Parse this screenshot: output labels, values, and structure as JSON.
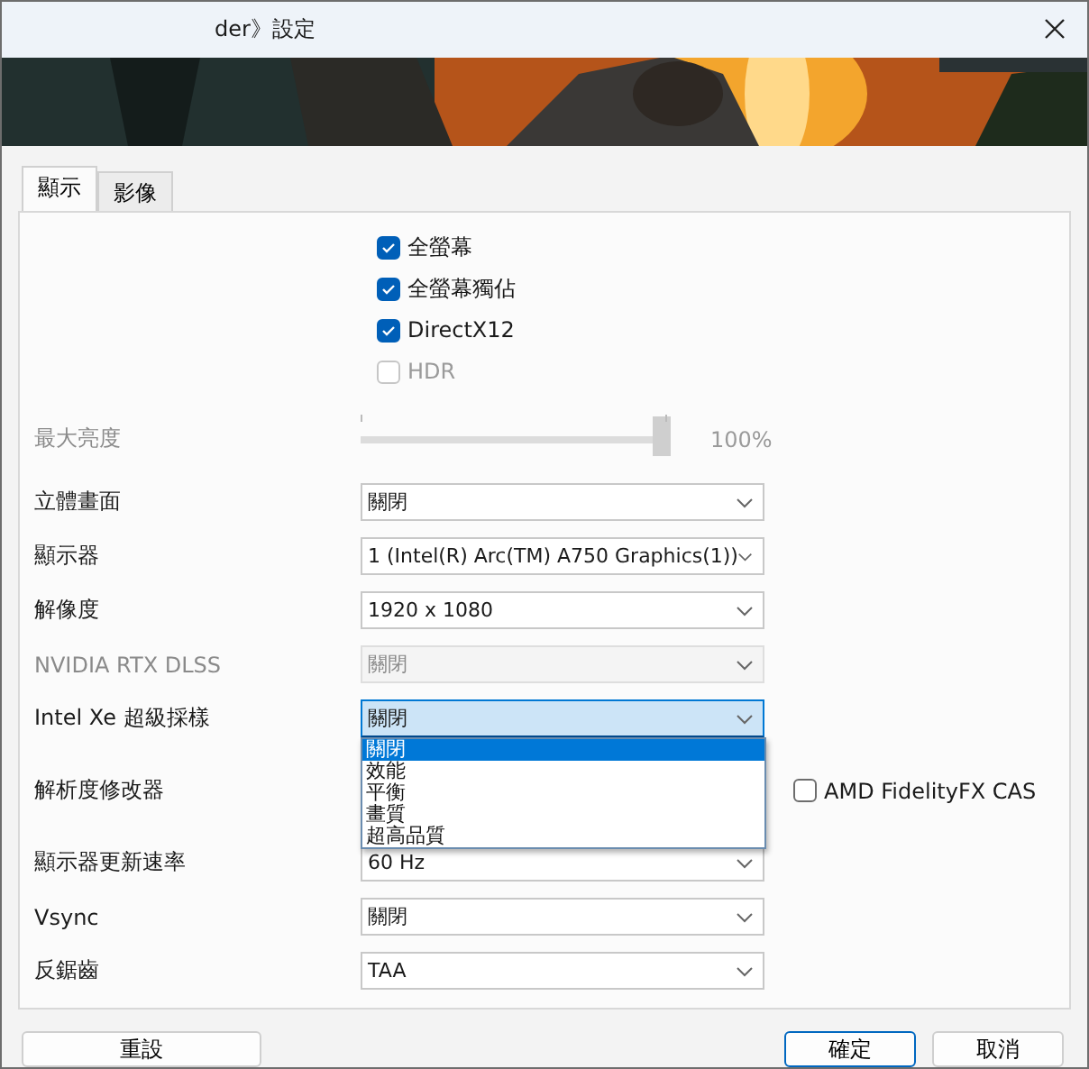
{
  "window": {
    "title": "der》設定"
  },
  "tabs": [
    {
      "label": "顯示",
      "selected": true
    },
    {
      "label": "影像",
      "selected": false
    }
  ],
  "checkboxes": [
    {
      "label": "全螢幕",
      "checked": true,
      "disabled": false
    },
    {
      "label": "全螢幕獨佔",
      "checked": true,
      "disabled": false
    },
    {
      "label": "DirectX12",
      "checked": true,
      "disabled": false
    },
    {
      "label": "HDR",
      "checked": false,
      "disabled": true
    }
  ],
  "brightness": {
    "label": "最大亮度",
    "level": 1,
    "reading": "100%",
    "disabled": true
  },
  "settings": [
    {
      "kind": "dropdown",
      "label": "立體畫面",
      "value": "關閉",
      "disabled": false,
      "focused": false
    },
    {
      "kind": "dropdown",
      "label": "顯示器",
      "value": "1 (Intel(R) Arc(TM) A750 Graphics(1))",
      "disabled": false,
      "focused": false
    },
    {
      "kind": "dropdown",
      "label": "解像度",
      "value": "1920 x 1080",
      "disabled": false,
      "focused": false
    },
    {
      "kind": "dropdown",
      "label": "NVIDIA RTX DLSS",
      "value": "關閉",
      "disabled": true,
      "focused": false
    },
    {
      "kind": "dropdown",
      "label": "Intel Xe 超級採樣",
      "value": "關閉",
      "disabled": false,
      "focused": true,
      "expanded": true,
      "options": [
        {
          "label": "關閉",
          "selected": true
        },
        {
          "label": "效能",
          "selected": false
        },
        {
          "label": "平衡",
          "selected": false
        },
        {
          "label": "畫質",
          "selected": false
        },
        {
          "label": "超高品質",
          "selected": false
        }
      ]
    },
    {
      "kind": "scaler",
      "label": "解析度修改器",
      "checkbox": {
        "label": "AMD FidelityFX CAS",
        "checked": false
      }
    },
    {
      "kind": "dropdown",
      "label": "顯示器更新速率",
      "value": "60 Hz",
      "disabled": false,
      "focused": false
    },
    {
      "kind": "dropdown",
      "label": "Vsync",
      "value": "關閉",
      "disabled": false,
      "focused": false
    },
    {
      "kind": "dropdown",
      "label": "反鋸齒",
      "value": "TAA",
      "disabled": false,
      "focused": false
    }
  ],
  "buttons": {
    "reset": "重設",
    "ok": "確定",
    "cancel": "取消"
  }
}
